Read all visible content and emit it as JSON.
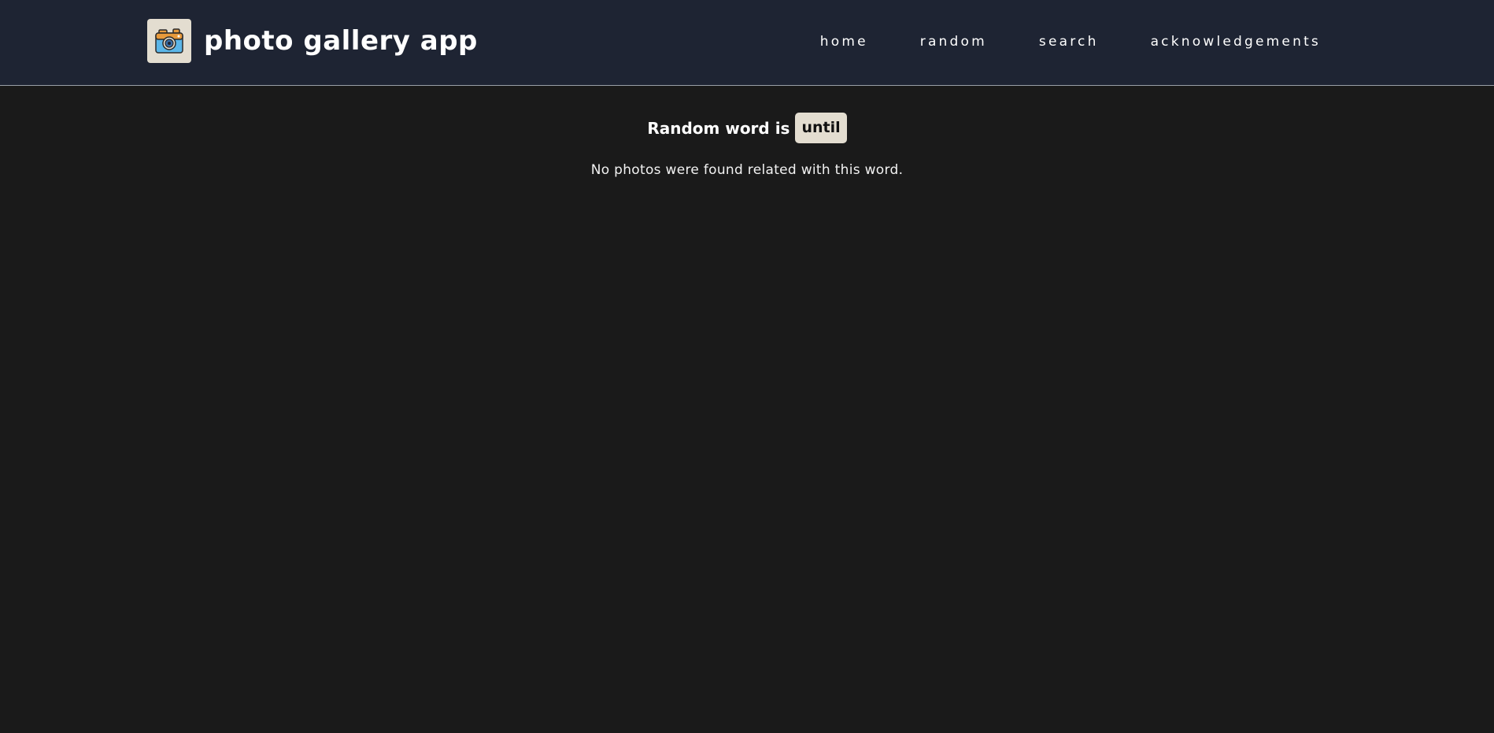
{
  "header": {
    "logo_icon": "camera-icon",
    "app_title": "photo gallery app",
    "nav": [
      {
        "label": "home"
      },
      {
        "label": "random"
      },
      {
        "label": "search"
      },
      {
        "label": "acknowledgements"
      }
    ]
  },
  "main": {
    "heading_prefix": "Random word is",
    "random_word": "until",
    "empty_message": "No photos were found related with this word."
  },
  "colors": {
    "page_background": "#1a1a1a",
    "navbar_background": "#1e2433",
    "badge_background": "#e3ddd0",
    "text": "#ffffff"
  }
}
